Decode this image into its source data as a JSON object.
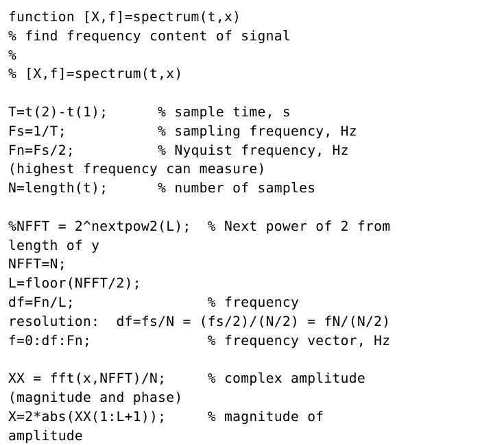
{
  "document": {
    "kind": "source-code-listing",
    "language": "MATLAB",
    "function_name": "spectrum",
    "background_color": "#ffffff",
    "text_color": "#000000",
    "lines": [
      "function [X,f]=spectrum(t,x)",
      "% find frequency content of signal",
      "%",
      "% [X,f]=spectrum(t,x)",
      "",
      "T=t(2)-t(1);      % sample time, s",
      "Fs=1/T;           % sampling frequency, Hz",
      "Fn=Fs/2;          % Nyquist frequency, Hz",
      "(highest frequency can measure)",
      "N=length(t);      % number of samples",
      "",
      "%NFFT = 2^nextpow2(L);  % Next power of 2 from",
      "length of y",
      "NFFT=N;",
      "L=floor(NFFT/2);",
      "df=Fn/L;                % frequency",
      "resolution:  df=fs/N = (fs/2)/(N/2) = fN/(N/2)",
      "f=0:df:Fn;              % frequency vector, Hz",
      "",
      "XX = fft(x,NFFT)/N;     % complex amplitude",
      "(magnitude and phase)",
      "X=2*abs(XX(1:L+1));     % magnitude of",
      "amplitude"
    ]
  }
}
